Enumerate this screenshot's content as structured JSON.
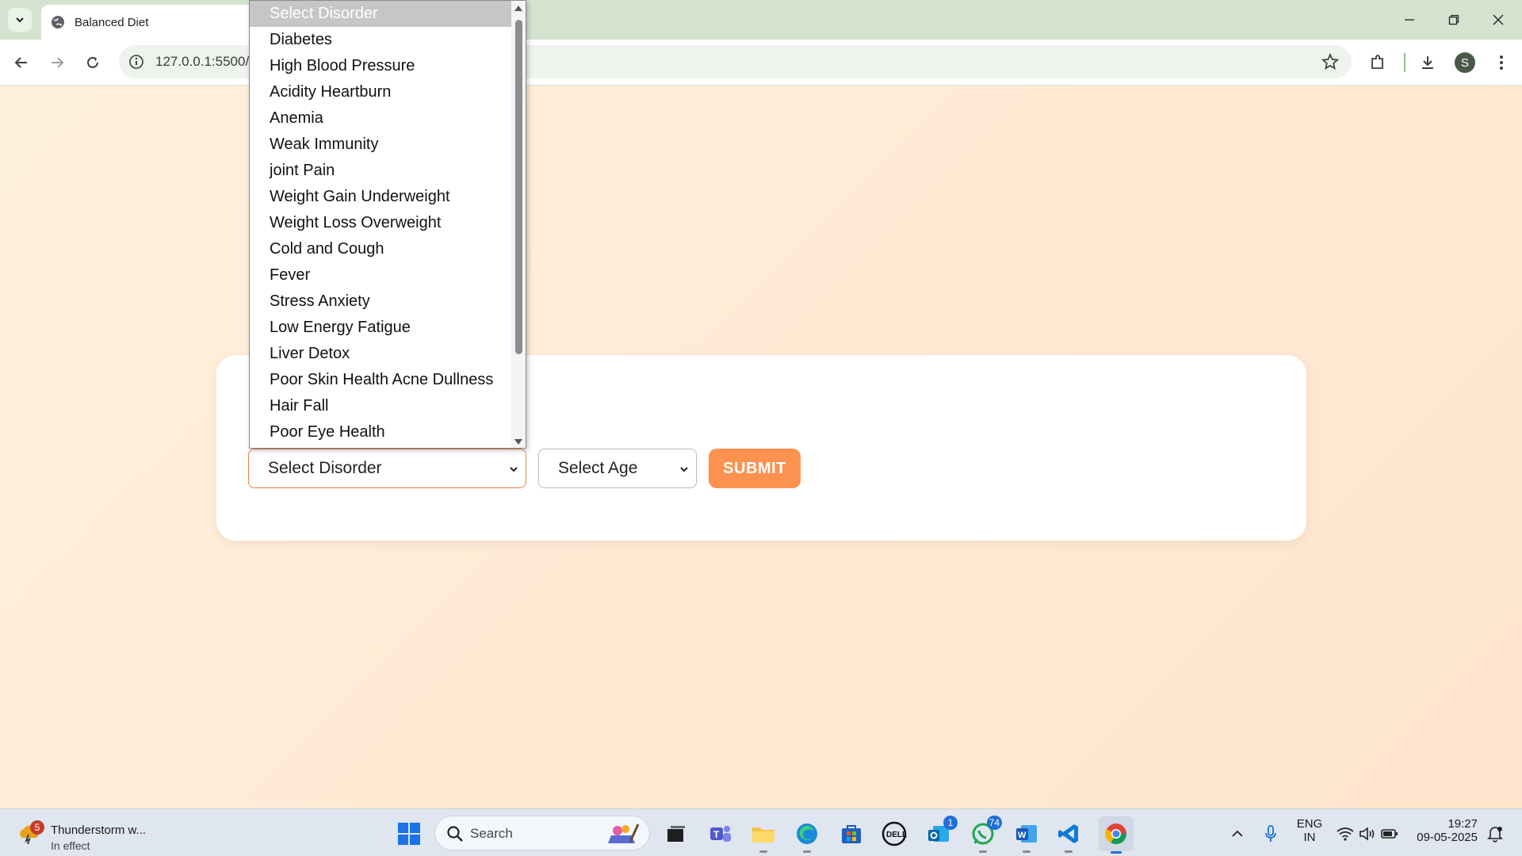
{
  "browser": {
    "tab_title": "Balanced Diet",
    "url": "127.0.0.1:5500/"
  },
  "form": {
    "disorder_select_value": "Select Disorder",
    "age_select_value": "Select Age",
    "submit_label": "SUBMIT"
  },
  "dropdown": {
    "options": [
      "Select Disorder",
      "Diabetes",
      "High Blood Pressure",
      "Acidity Heartburn",
      "Anemia",
      "Weak Immunity",
      "joint Pain",
      "Weight Gain Underweight",
      "Weight Loss Overweight",
      "Cold and Cough",
      "Fever",
      "Stress Anxiety",
      "Low Energy Fatigue",
      "Liver Detox",
      "Poor Skin Health Acne Dullness",
      "Hair Fall",
      "Poor Eye Health"
    ],
    "selected_index": 0
  },
  "taskbar": {
    "weather_badge": "5",
    "weather_title": "Thunderstorm w...",
    "weather_status": "In effect",
    "search_placeholder": "Search",
    "outlook_badge": "1",
    "whatsapp_badge": "74",
    "language_line1": "ENG",
    "language_line2": "IN",
    "time": "19:27",
    "date": "09-05-2025"
  },
  "profile_initial": "S",
  "colors": {
    "accent": "#fb9250",
    "page_bg": "#ffeada",
    "tabbar_bg": "#d3e3d0"
  }
}
